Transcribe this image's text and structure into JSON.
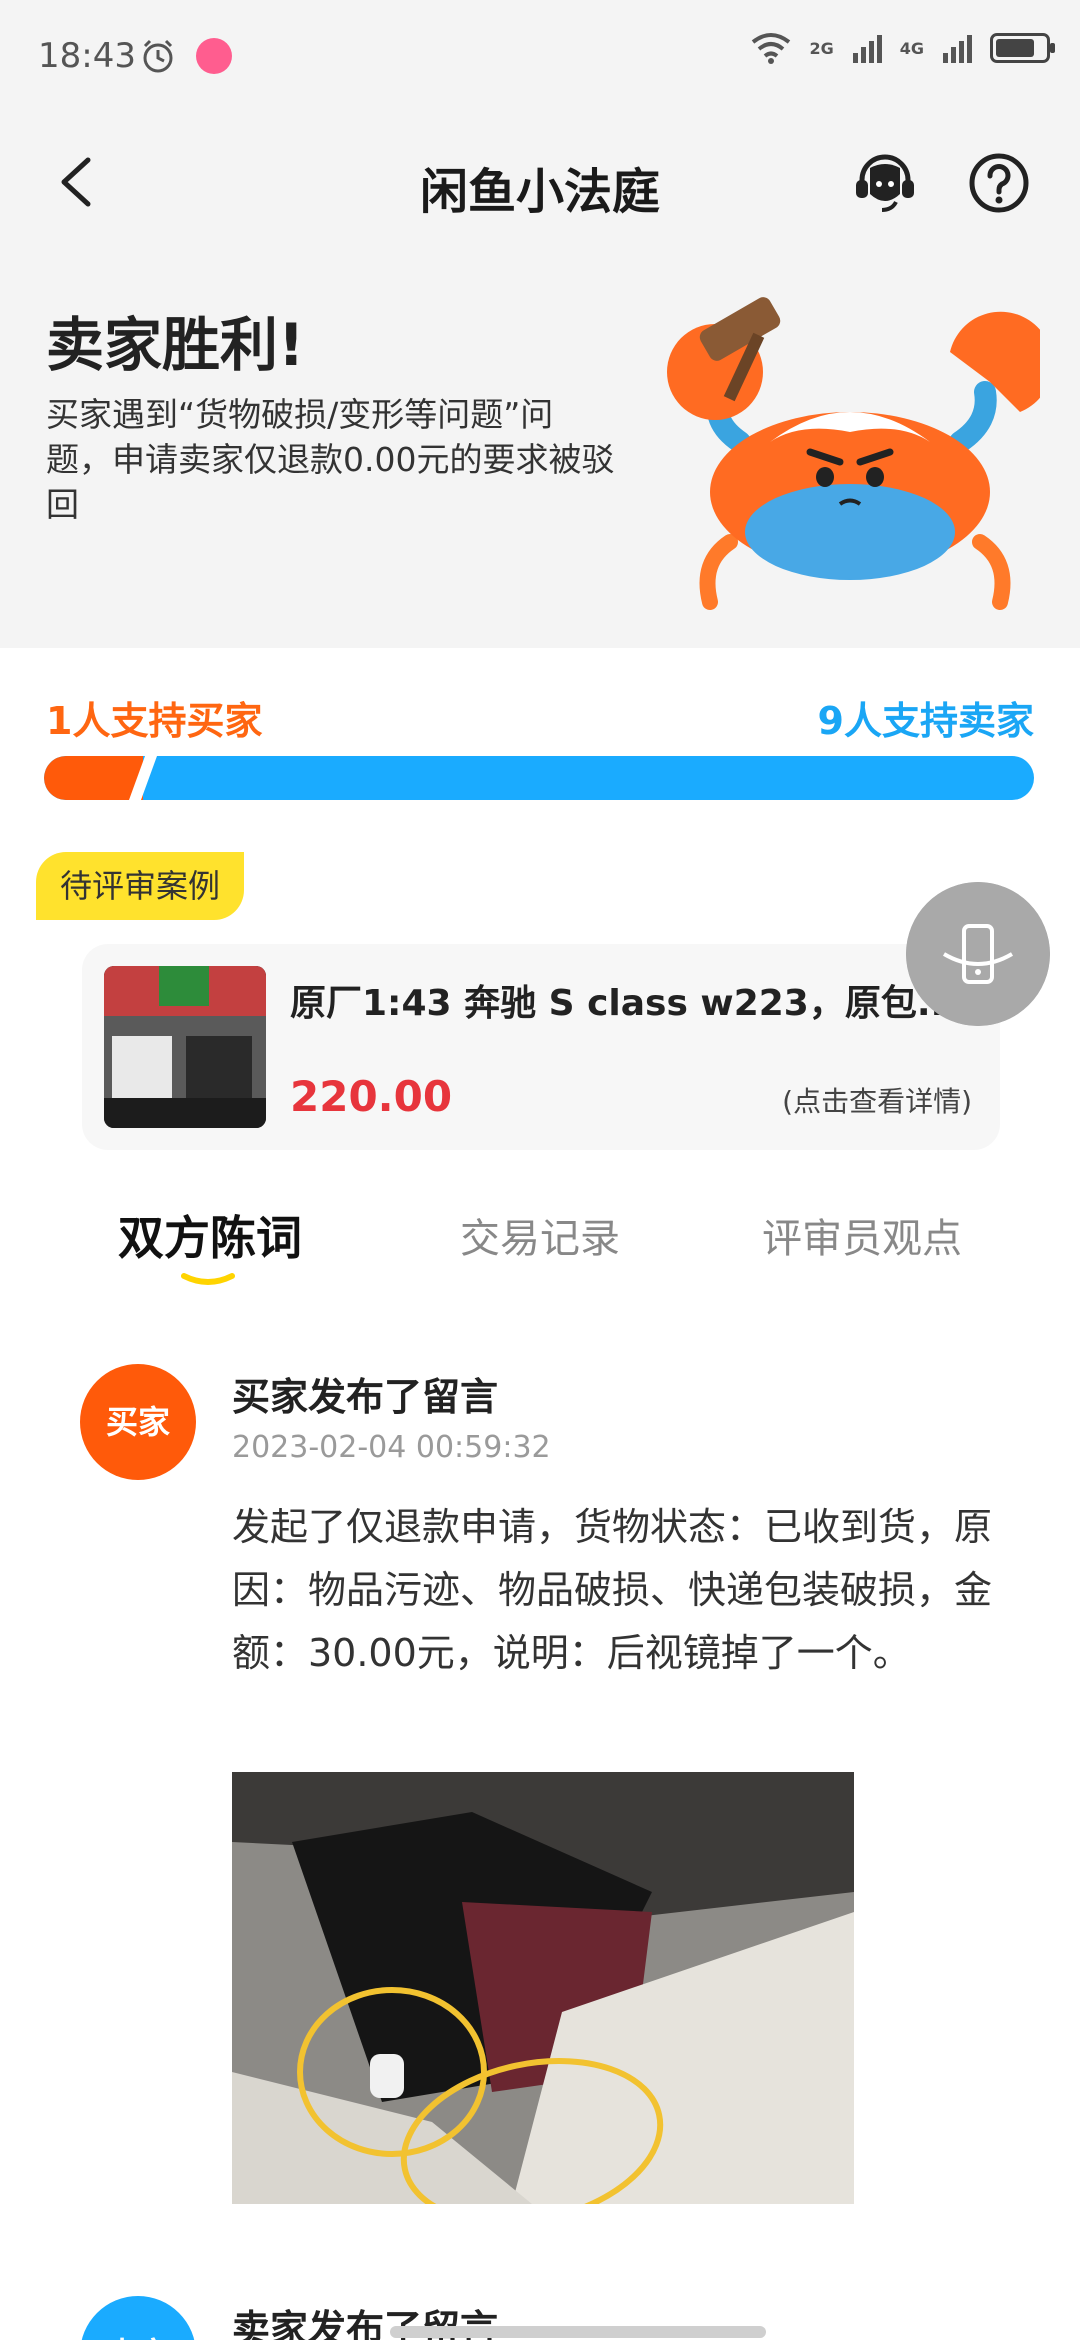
{
  "status_bar": {
    "time": "18:43",
    "net1": "2G",
    "net2": "4G",
    "battery_level": 0.8,
    "icons": [
      "alarm-icon",
      "app-notification-icon",
      "wifi-icon",
      "signal-icon",
      "battery-icon"
    ]
  },
  "header": {
    "title": "闲鱼小法庭",
    "icons": [
      "back-arrow-icon",
      "customer-service-icon",
      "help-question-icon"
    ]
  },
  "verdict": {
    "title": "卖家胜利!",
    "description": "买家遇到“货物破损/变形等问题”问题，申请卖家仅退款0.00元的要求被驳回"
  },
  "support": {
    "buyer_label": "1人支持买家",
    "seller_label": "9人支持卖家",
    "buyer_count": 1,
    "seller_count": 9,
    "colors": {
      "buyer": "#ff5a0a",
      "seller": "#1aabff"
    }
  },
  "pending_case": {
    "tag": "待评审案例",
    "title": "原厂1:43 奔驰 S class w223，原包...",
    "price": "220.00",
    "detail_link": "(点击查看详情)"
  },
  "tabs": [
    {
      "label": "双方陈词",
      "active": true
    },
    {
      "label": "交易记录",
      "active": false
    },
    {
      "label": "评审员观点",
      "active": false
    }
  ],
  "messages": [
    {
      "avatar_label": "买家",
      "avatar_color": "#ff5a0a",
      "title": "买家发布了留言",
      "time": "2023-02-04 00:59:32",
      "body": "发起了仅退款申请，货物状态：已收到货，原因：物品污迹、物品破损、快递包装破损，金额：30.00元，说明：后视镜掉了一个。"
    },
    {
      "avatar_label": "卖家",
      "avatar_color": "#1aabff",
      "title": "卖家发布了留言"
    }
  ]
}
